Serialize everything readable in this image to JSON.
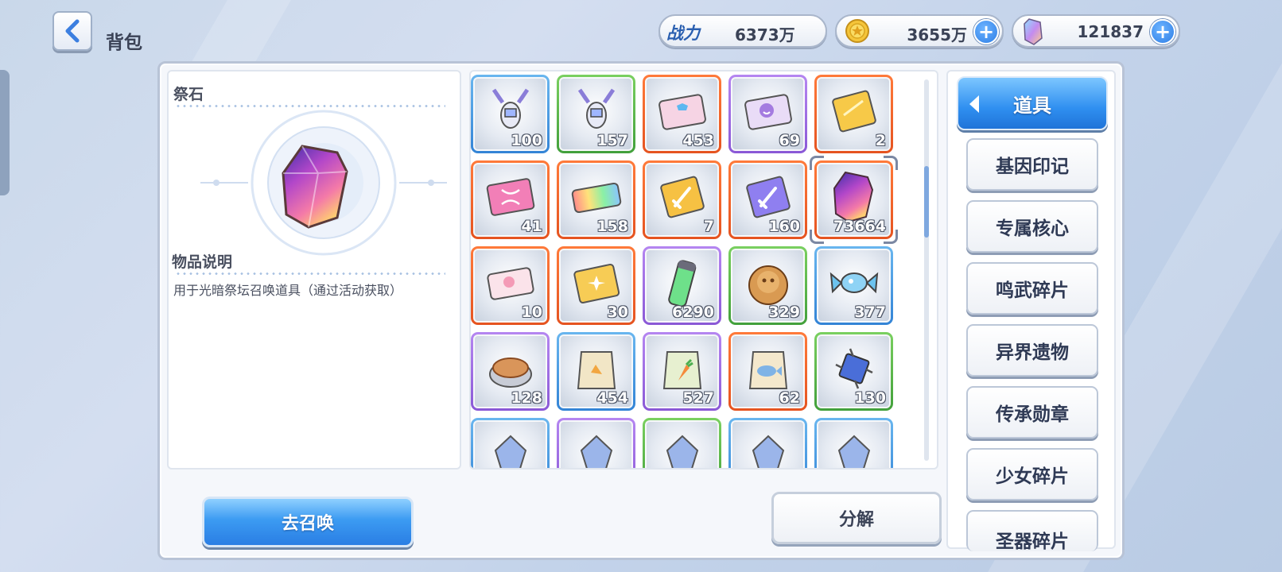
{
  "header": {
    "title": "背包",
    "power_label": "战力",
    "power_value": "6373万",
    "gold_value": "3655万",
    "crystal_value": "121837"
  },
  "detail": {
    "name": "祭石",
    "desc_label": "物品说明",
    "desc_text": "用于光暗祭坛召唤道具（通过活动获取）",
    "summon_label": "去召唤"
  },
  "grid": {
    "decompose_label": "分解",
    "scroll_position": 0.28,
    "items": [
      {
        "icon": "lobster-icon",
        "count": "100",
        "rarity": "blue"
      },
      {
        "icon": "lobster-icon",
        "count": "157",
        "rarity": "green"
      },
      {
        "icon": "ticket-shirt-icon",
        "count": "453",
        "rarity": "orange"
      },
      {
        "icon": "ticket-smile-icon",
        "count": "69",
        "rarity": "purple"
      },
      {
        "icon": "gold-card-icon",
        "count": "2",
        "rarity": "orange"
      },
      {
        "icon": "dna-card-icon",
        "count": "41",
        "rarity": "orange"
      },
      {
        "icon": "rainbow-ticket-icon",
        "count": "158",
        "rarity": "orange"
      },
      {
        "icon": "sword-card-gold-icon",
        "count": "7",
        "rarity": "orange"
      },
      {
        "icon": "sword-card-purple-icon",
        "count": "160",
        "rarity": "orange"
      },
      {
        "icon": "crystal-icon",
        "count": "73664",
        "rarity": "orange",
        "selected": true
      },
      {
        "icon": "pink-ticket-icon",
        "count": "10",
        "rarity": "orange"
      },
      {
        "icon": "gold-star-card-icon",
        "count": "30",
        "rarity": "orange"
      },
      {
        "icon": "green-vial-icon",
        "count": "6290",
        "rarity": "purple"
      },
      {
        "icon": "cookie-icon",
        "count": "329",
        "rarity": "green"
      },
      {
        "icon": "candy-icon",
        "count": "377",
        "rarity": "blue"
      },
      {
        "icon": "bread-tin-icon",
        "count": "128",
        "rarity": "purple"
      },
      {
        "icon": "snack-bag-icon",
        "count": "454",
        "rarity": "blue"
      },
      {
        "icon": "carrot-bag-icon",
        "count": "527",
        "rarity": "purple"
      },
      {
        "icon": "fish-bag-icon",
        "count": "62",
        "rarity": "orange"
      },
      {
        "icon": "chip-icon",
        "count": "130",
        "rarity": "green"
      },
      {
        "icon": "partial-item-icon",
        "count": "",
        "rarity": "blue"
      },
      {
        "icon": "partial-item-icon",
        "count": "",
        "rarity": "purple"
      },
      {
        "icon": "partial-item-icon",
        "count": "",
        "rarity": "green"
      },
      {
        "icon": "partial-item-icon",
        "count": "",
        "rarity": "blue"
      },
      {
        "icon": "partial-item-icon",
        "count": "",
        "rarity": "blue"
      }
    ]
  },
  "categories": {
    "active": "道具",
    "items": [
      "基因印记",
      "专属核心",
      "鸣武碎片",
      "异界遗物",
      "传承勋章",
      "少女碎片",
      "圣器碎片"
    ]
  },
  "colors": {
    "accent_blue": "#2f8ff0",
    "rarity_orange": "#e55320",
    "rarity_purple": "#8a58d6",
    "rarity_green": "#42a03b",
    "rarity_blue": "#3384d6"
  }
}
